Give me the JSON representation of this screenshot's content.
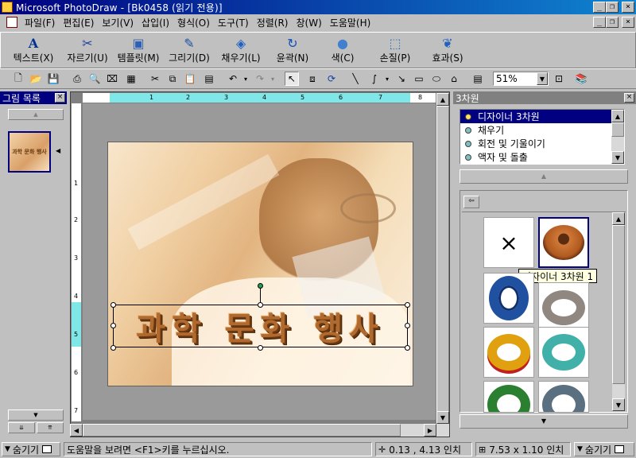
{
  "window": {
    "title": "Microsoft PhotoDraw - [Bk0458 (읽기 전용)]"
  },
  "menu": {
    "items": [
      "파일(F)",
      "편집(E)",
      "보기(V)",
      "삽입(I)",
      "형식(O)",
      "도구(T)",
      "정렬(R)",
      "창(W)",
      "도움말(H)"
    ]
  },
  "big_toolbar": {
    "text": "텍스트(X)",
    "crop": "자르기(U)",
    "template": "템플릿(M)",
    "draw": "그리기(D)",
    "fill": "채우기(L)",
    "outline": "윤곽(N)",
    "color": "색(C)",
    "retouch": "손질(P)",
    "effect": "효과(S)"
  },
  "small_toolbar": {
    "zoom": "51%"
  },
  "picture_list": {
    "title": "그림 목록",
    "thumb_text": "과학 문화 행사"
  },
  "canvas": {
    "art_text": "과학 문화 행사",
    "ruler_numbers": [
      "1",
      "2",
      "3",
      "4",
      "5",
      "6",
      "7",
      "8"
    ],
    "vruler_numbers": [
      "1",
      "2",
      "3",
      "4",
      "5",
      "6",
      "7"
    ]
  },
  "right_pane": {
    "title": "3차원",
    "list": [
      "디자이너 3차원",
      "채우기",
      "회전 및 기울이기",
      "액자 및 돌출"
    ],
    "tooltip": "디자이너 3차원 1"
  },
  "status": {
    "left_hide": "숨기기",
    "help": "도움말을 보려면 <F1>키를 누르십시오.",
    "position": "0.13 , 4.13 인치",
    "size": "7.53 x 1.10 인치",
    "right_hide": "숨기기"
  },
  "colors": {
    "title_start": "#000080",
    "title_end": "#1084d0",
    "ruler_highlight": "#7fe7e7",
    "selected": "#000080"
  }
}
